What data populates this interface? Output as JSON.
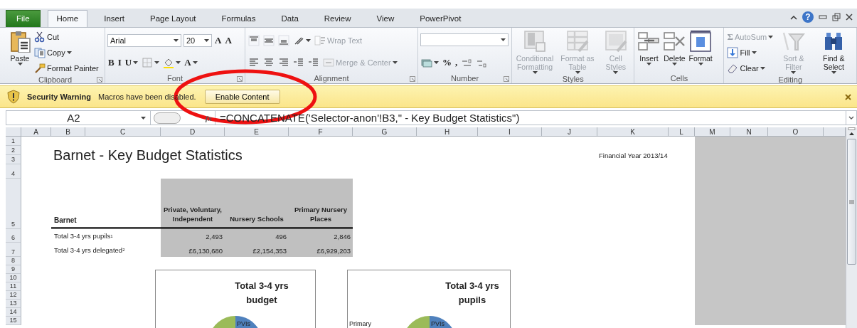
{
  "tabs": [
    {
      "label": "File",
      "kind": "file",
      "selected": false
    },
    {
      "label": "Home",
      "kind": "tab",
      "selected": true
    },
    {
      "label": "Insert",
      "kind": "tab",
      "selected": false
    },
    {
      "label": "Page Layout",
      "kind": "tab",
      "selected": false
    },
    {
      "label": "Formulas",
      "kind": "tab",
      "selected": false
    },
    {
      "label": "Data",
      "kind": "tab",
      "selected": false
    },
    {
      "label": "Review",
      "kind": "tab",
      "selected": false
    },
    {
      "label": "View",
      "kind": "tab",
      "selected": false
    },
    {
      "label": "PowerPivot",
      "kind": "tab",
      "selected": false
    }
  ],
  "help": "?",
  "ribbon_groups": [
    {
      "label": "Clipboard",
      "launcher": true,
      "stacks": [
        {
          "kind": "large",
          "item": {
            "label": "Paste",
            "dropdown": true,
            "disabled": false
          }
        },
        {
          "kind": "rows",
          "rows": [
            {
              "items": [
                {
                  "kind": "button",
                  "label": "Cut",
                  "dropdown": false,
                  "disabled": false
                }
              ]
            },
            {
              "items": [
                {
                  "kind": "button",
                  "label": "Copy",
                  "dropdown": true,
                  "disabled": false
                }
              ]
            },
            {
              "items": [
                {
                  "kind": "button",
                  "label": "Format Painter",
                  "dropdown": false,
                  "disabled": false
                }
              ]
            }
          ]
        }
      ]
    },
    {
      "label": "Font",
      "launcher": true,
      "stacks": [
        {
          "kind": "rows",
          "rows": [
            {
              "items": [
                {
                  "kind": "font-combo",
                  "value": "Arial"
                },
                {
                  "kind": "size-combo",
                  "value": "20"
                },
                {
                  "kind": "button",
                  "glyph": "A",
                  "dropdown": false,
                  "disabled": false
                },
                {
                  "kind": "button",
                  "glyph": "A",
                  "dropdown": false,
                  "disabled": false
                }
              ]
            },
            {
              "items": [
                {
                  "kind": "button",
                  "glyph": "B",
                  "dropdown": false,
                  "disabled": false
                },
                {
                  "kind": "button",
                  "glyph": "I",
                  "dropdown": false,
                  "disabled": false
                },
                {
                  "kind": "button",
                  "glyph": "U",
                  "dropdown": true,
                  "disabled": false
                },
                {
                  "kind": "button",
                  "dropdown": true,
                  "disabled": false
                },
                {
                  "kind": "button",
                  "dropdown": true,
                  "disabled": false
                },
                {
                  "kind": "button",
                  "glyph": "A",
                  "dropdown": true,
                  "disabled": false
                }
              ]
            }
          ]
        }
      ]
    },
    {
      "label": "Alignment",
      "launcher": true,
      "stacks": [
        {
          "kind": "rows",
          "rows": [
            {
              "items": [
                {
                  "kind": "button",
                  "dropdown": false,
                  "disabled": false
                },
                {
                  "kind": "button",
                  "dropdown": false,
                  "disabled": false
                },
                {
                  "kind": "button",
                  "dropdown": false,
                  "disabled": false
                },
                {
                  "kind": "button",
                  "dropdown": true,
                  "disabled": false
                },
                {
                  "kind": "button",
                  "label": "Wrap Text",
                  "dropdown": false,
                  "disabled": true
                }
              ]
            },
            {
              "items": [
                {
                  "kind": "button",
                  "dropdown": false,
                  "disabled": false
                },
                {
                  "kind": "button",
                  "dropdown": false,
                  "disabled": false
                },
                {
                  "kind": "button",
                  "dropdown": false,
                  "disabled": false
                },
                {
                  "kind": "button",
                  "dropdown": false,
                  "disabled": false
                },
                {
                  "kind": "button",
                  "dropdown": false,
                  "disabled": false
                },
                {
                  "kind": "button",
                  "label": "Merge & Center",
                  "dropdown": true,
                  "disabled": true
                }
              ]
            }
          ]
        }
      ]
    },
    {
      "label": "Number",
      "launcher": true,
      "stacks": [
        {
          "kind": "rows",
          "rows": [
            {
              "items": [
                {
                  "kind": "format-combo"
                }
              ]
            },
            {
              "items": [
                {
                  "kind": "button",
                  "dropdown": true,
                  "disabled": false
                },
                {
                  "kind": "button",
                  "glyph": "%",
                  "dropdown": false,
                  "disabled": false
                },
                {
                  "kind": "button",
                  "glyph": ",",
                  "dropdown": false,
                  "disabled": false
                },
                {
                  "kind": "button",
                  "dropdown": false,
                  "disabled": false
                },
                {
                  "kind": "button",
                  "dropdown": false,
                  "disabled": false
                }
              ]
            }
          ]
        }
      ]
    },
    {
      "label": "Styles",
      "launcher": false,
      "stacks": [
        {
          "kind": "large",
          "item": {
            "label": "Conditional Formatting",
            "dropdown": true,
            "disabled": true
          }
        },
        {
          "kind": "large",
          "item": {
            "label": "Format as Table",
            "dropdown": true,
            "disabled": true
          }
        },
        {
          "kind": "large",
          "item": {
            "label": "Cell Styles",
            "dropdown": true,
            "disabled": true
          }
        }
      ]
    },
    {
      "label": "Cells",
      "launcher": false,
      "stacks": [
        {
          "kind": "large",
          "item": {
            "label": "Insert",
            "dropdown": true,
            "disabled": false
          }
        },
        {
          "kind": "large",
          "item": {
            "label": "Delete",
            "dropdown": true,
            "disabled": false
          }
        },
        {
          "kind": "large",
          "item": {
            "label": "Format",
            "dropdown": true,
            "disabled": false
          }
        }
      ]
    },
    {
      "label": "Editing",
      "launcher": false,
      "stacks": [
        {
          "kind": "rows",
          "rows": [
            {
              "items": [
                {
                  "kind": "button",
                  "glyph": "Σ",
                  "label": "AutoSum",
                  "dropdown": true,
                  "disabled": true
                }
              ]
            },
            {
              "items": [
                {
                  "kind": "button",
                  "label": "Fill",
                  "dropdown": true,
                  "disabled": false
                }
              ]
            },
            {
              "items": [
                {
                  "kind": "button",
                  "label": "Clear",
                  "dropdown": true,
                  "disabled": false
                }
              ]
            }
          ]
        },
        {
          "kind": "large",
          "item": {
            "label": "Sort & Filter",
            "dropdown": true,
            "disabled": true
          }
        },
        {
          "kind": "large",
          "item": {
            "label": "Find & Select",
            "dropdown": true,
            "disabled": false
          }
        }
      ]
    }
  ],
  "security_bar": {
    "title": "Security Warning",
    "message": "Macros have been disabled.",
    "button": "Enable Content"
  },
  "formula_bar": {
    "name_box": "A2",
    "fx": "fx",
    "formula": "=CONCATENATE('Selector-anon'!B3,\" - Key Budget Statistics\")"
  },
  "sheet": {
    "columns": [
      {
        "label": "A",
        "shaded": false
      },
      {
        "label": "B",
        "shaded": false
      },
      {
        "label": "C",
        "shaded": false
      },
      {
        "label": "D",
        "shaded": false
      },
      {
        "label": "E",
        "shaded": false
      },
      {
        "label": "F",
        "shaded": false
      },
      {
        "label": "G",
        "shaded": false
      },
      {
        "label": "H",
        "shaded": false
      },
      {
        "label": "I",
        "shaded": false
      },
      {
        "label": "J",
        "shaded": false
      },
      {
        "label": "K",
        "shaded": false
      },
      {
        "label": "L",
        "shaded": false
      },
      {
        "label": "M",
        "shaded": true
      },
      {
        "label": "N",
        "shaded": true
      },
      {
        "label": "O",
        "shaded": true
      }
    ],
    "rows": [
      "1",
      "2",
      "3",
      "4",
      "5",
      "6",
      "7",
      "8",
      "9",
      "10",
      "11",
      "12",
      "13",
      "14",
      "15"
    ],
    "title": "Barnet - Key Budget Statistics",
    "financial_year": "Financial Year 2013/14",
    "table": {
      "corner": "Barnet",
      "columns": [
        "Private, Voluntary, Independent",
        "Nursery Schools",
        "Primary Nursery Places"
      ],
      "rows": [
        {
          "label": "Total 3-4 yrs pupils$^{1}$",
          "values": [
            "2,493",
            "496",
            "2,846"
          ]
        },
        {
          "label": "Total 3-4 yrs delegated$^{2}$",
          "values": [
            "£6,130,680",
            "£2,154,353",
            "£6,929,203"
          ]
        }
      ]
    },
    "charts": [
      {
        "title": "Total 3-4 yrs budget",
        "labels": [
          {
            "text": "PVIs",
            "kind": "inside"
          }
        ]
      },
      {
        "title": "Total 3-4 yrs pupils",
        "labels": [
          {
            "text": "Primary",
            "kind": "outside"
          },
          {
            "text": "PVIs",
            "kind": "inside"
          }
        ]
      }
    ]
  },
  "annotation_ellipse": true
}
